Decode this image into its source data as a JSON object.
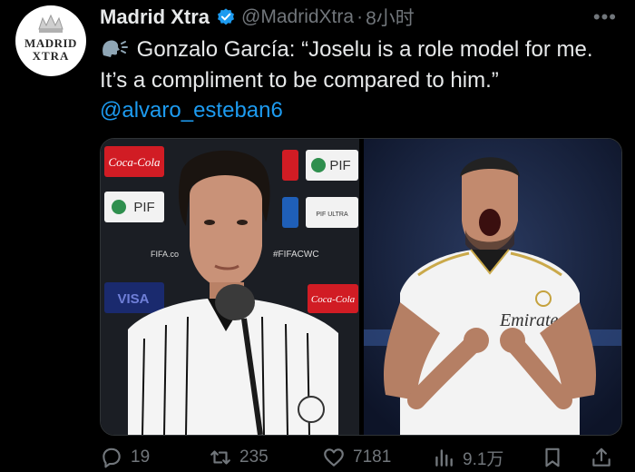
{
  "account": {
    "name": "Madrid Xtra",
    "handle": "@MadridXtra",
    "separator": "·",
    "time": "8小时",
    "avatar_line1": "MADRID",
    "avatar_line2": "XTRA"
  },
  "tweet": {
    "text": "Gonzalo García: “Joselu is a role model for me. It’s a compliment to be compared to him.”",
    "mention": "@alvaro_esteban6"
  },
  "media": {
    "left_banner_brands": [
      "Coca-Cola",
      "PIF",
      "PIF",
      "PIF ULTRA",
      "#FIFACWC",
      "FIFA.co",
      "VISA",
      "Coca-Cola"
    ],
    "right_shirt_text": "Emirates"
  },
  "actions": {
    "replies": "19",
    "reposts": "235",
    "likes": "7181",
    "views": "9.1万"
  },
  "colors": {
    "background": "#000000",
    "text": "#e7e9ea",
    "muted": "#71767b",
    "link": "#1d9bf0",
    "verified": "#1d9bf0"
  },
  "icons": [
    "speaking-head-icon",
    "verified-badge-icon",
    "more-icon",
    "reply-icon",
    "repost-icon",
    "like-icon",
    "views-icon",
    "bookmark-icon",
    "share-icon"
  ]
}
